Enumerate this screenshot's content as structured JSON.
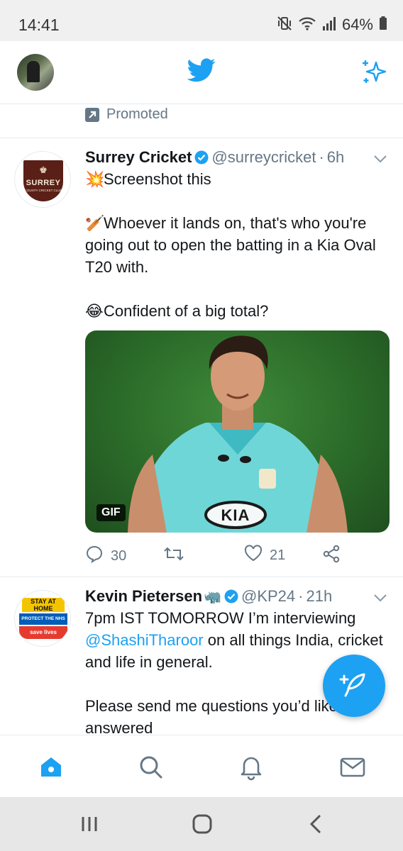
{
  "status_bar": {
    "time": "14:41",
    "battery": "64%",
    "icons": [
      "mute-vibrate-icon",
      "wifi-icon",
      "signal-icon",
      "battery-icon"
    ]
  },
  "header": {
    "logo_icon": "twitter-bird-icon",
    "right_icon": "sparkle-icon",
    "accent_color": "#1da1f2"
  },
  "promoted": {
    "label": "Promoted",
    "icon": "promoted-arrow-icon"
  },
  "tweets": [
    {
      "name": "Surrey Cricket",
      "handle": "@surreycricket",
      "dot": "·",
      "time": "6h",
      "verified": true,
      "avatar": {
        "crest": "♚",
        "name": "SURREY",
        "sub": "COUNTY CRICKET CLUB"
      },
      "paragraphs": [
        {
          "emoji": "💥",
          "text": "Screenshot this"
        },
        {
          "emoji": "🏏",
          "text": "Whoever it lands on, that's who you're going out to open the batting in a Kia Oval T20 with."
        },
        {
          "emoji": "😂",
          "text": "Confident of a big total?"
        }
      ],
      "media": {
        "badge": "GIF",
        "shirt_text": "KIA"
      },
      "actions": {
        "reply_count": "30",
        "retweet_count": "",
        "like_count": "21"
      }
    },
    {
      "name": "Kevin Pietersen",
      "name_emoji": "🦏",
      "handle": "@KP24",
      "dot": "·",
      "time": "21h",
      "verified": true,
      "avatar": {
        "stay": "STAY AT HOME",
        "protect": "PROTECT THE NHS",
        "save": "save lives"
      },
      "text_lead": "7pm IST TOMORROW I’m interviewing",
      "mention": "@ShashiTharoor",
      "text_rest": " on all things India, cricket and life in general.",
      "text_2": "Please send me questions you’d like answered"
    }
  ],
  "bottom_nav": {
    "items": [
      "home-icon",
      "search-icon",
      "notifications-icon",
      "messages-icon"
    ],
    "active": "home-icon"
  },
  "compose_fab": {
    "icon": "compose-feather-icon"
  },
  "android_nav": {
    "items": [
      "recent-apps-icon",
      "home-button-icon",
      "back-icon"
    ]
  }
}
